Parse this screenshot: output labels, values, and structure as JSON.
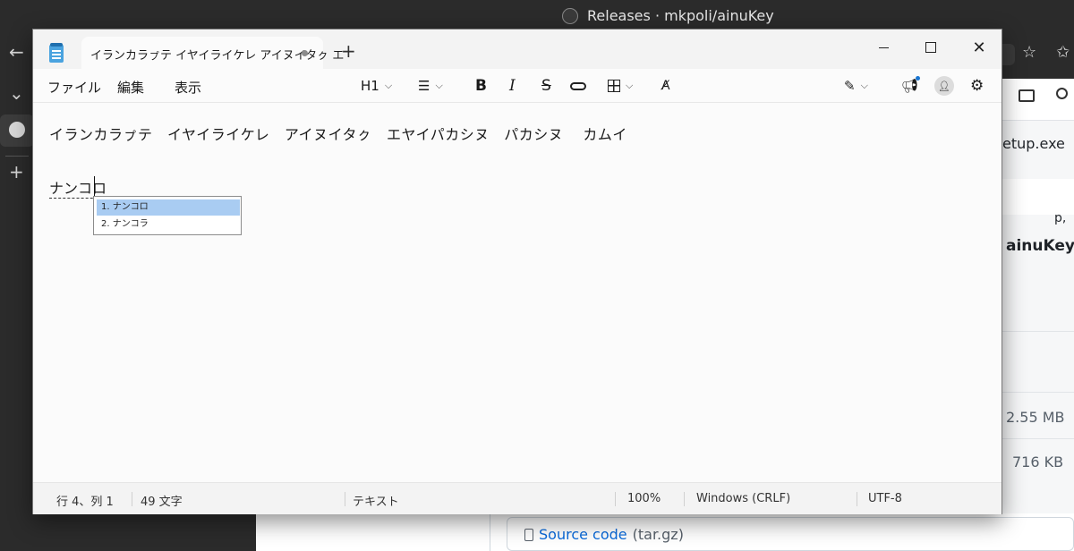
{
  "browser": {
    "window_title": "Releases · mkpoli/ainuKey",
    "sidebar": {
      "back_glyph": "←",
      "collapse_glyph": "⌄",
      "add_glyph": "+"
    },
    "page_fragments": {
      "file_name": "etup.exe",
      "repo_name": "ainuKey.",
      "size_1": "2.55 MB",
      "size_2": "716 KB",
      "source_label": "Source code",
      "source_suffix": "(tar.gz)",
      "partial_mark": "p,"
    }
  },
  "notepad": {
    "tab_title": "イランカラㇷ゚テ イヤイライケレ アイヌイタㇰ エ",
    "new_tab": "+",
    "menu": {
      "file": "ファイル",
      "edit": "編集",
      "view": "表示"
    },
    "toolbar": {
      "heading": "H1",
      "bold": "B",
      "italic": "I",
      "strike": "S"
    },
    "content": {
      "line1": "イランカラㇷ゚テ　イヤイライケレ　アイヌイタㇰ　エヤイパカシヌ　パカシヌ　 カムイ",
      "line4": "ナンコロ"
    },
    "ime_candidates": [
      {
        "label": "1. ナンコロ",
        "selected": true
      },
      {
        "label": "2. ナンコラ",
        "selected": false
      }
    ],
    "status": {
      "position": "行 4、列 1",
      "char_count": "49 文字",
      "mode": "テキスト",
      "zoom": "100%",
      "line_ending": "Windows (CRLF)",
      "encoding": "UTF-8"
    }
  },
  "colors": {
    "browser_dark": "#2b2b2b",
    "notepad_bg": "#fbfbfb",
    "ime_selected": "#a9ccf2",
    "link_blue": "#0969da"
  }
}
